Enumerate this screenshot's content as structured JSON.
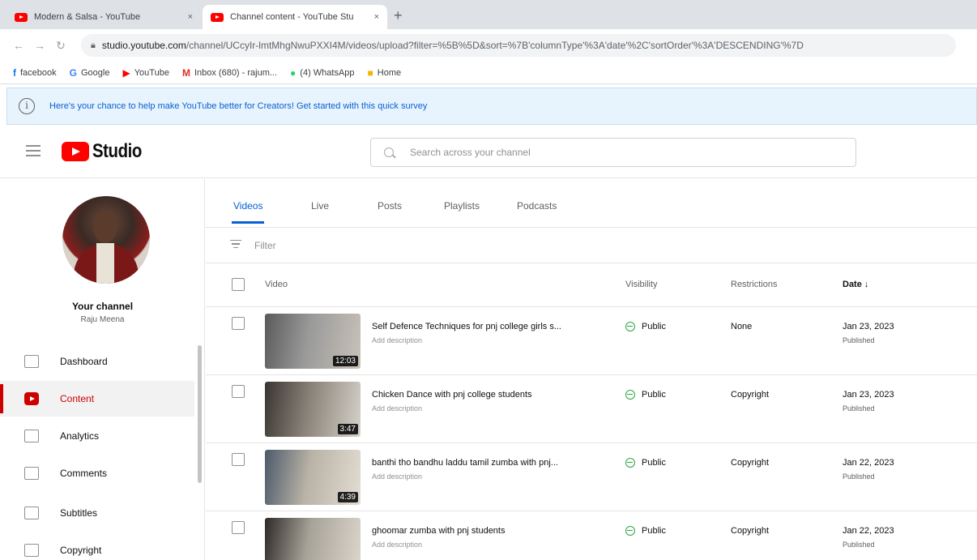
{
  "browser": {
    "tabs": [
      {
        "title": "Modern & Salsa - YouTube",
        "close": "×"
      },
      {
        "title": "Channel content - YouTube Stu",
        "close": "×"
      }
    ],
    "new_tab": "+",
    "url_host": "studio.youtube.com",
    "url_path": "/channel/UCcyIr-lmtMhgNwuPXXI4M/videos/upload?filter=%5B%5D&sort=%7B'columnType'%3A'date'%2C'sortOrder'%3A'DESCENDING'%7D",
    "bookmarks": [
      {
        "icon": "f",
        "label": "facebook"
      },
      {
        "icon": "G",
        "label": "Google"
      },
      {
        "icon": "▶",
        "label": "YouTube"
      },
      {
        "icon": "M",
        "label": "Inbox (680) - rajum..."
      },
      {
        "icon": "●",
        "label": "(4) WhatsApp"
      },
      {
        "icon": "■",
        "label": "Home"
      }
    ]
  },
  "banner": {
    "icon": "i",
    "text": "Here's your chance to help make YouTube better for Creators! Get started with this quick survey"
  },
  "header": {
    "logo_word": "Studio",
    "search_placeholder": "Search across your channel"
  },
  "sidebar": {
    "channel_name": "Your channel",
    "channel_sub": "Raju Meena",
    "items": [
      {
        "label": "Dashboard",
        "active": false
      },
      {
        "label": "Content",
        "active": true
      },
      {
        "label": "Analytics",
        "active": false
      },
      {
        "label": "Comments",
        "active": false
      },
      {
        "label": "Subtitles",
        "active": false
      },
      {
        "label": "Copyright",
        "active": false
      }
    ]
  },
  "content_tabs": [
    {
      "label": "Videos",
      "active": true
    },
    {
      "label": "Live",
      "active": false
    },
    {
      "label": "Posts",
      "active": false
    },
    {
      "label": "Playlists",
      "active": false
    },
    {
      "label": "Podcasts",
      "active": false
    }
  ],
  "filter": {
    "placeholder": "Filter"
  },
  "table": {
    "headers": {
      "video": "Video",
      "visibility": "Visibility",
      "restrictions": "Restrictions",
      "date": "Date ↓"
    },
    "rows": [
      {
        "title": "Self Defence Techniques for pnj college girls s...",
        "desc": "Add description",
        "duration": "12:03",
        "visibility": "Public",
        "restrictions": "None",
        "date": "Jan 23, 2023",
        "status": "Published",
        "thumb_colors": [
          "#5a5a5a",
          "#9a9a9a",
          "#c8c2b8"
        ]
      },
      {
        "title": "Chicken Dance with pnj college students",
        "desc": "Add description",
        "duration": "3:47",
        "visibility": "Public",
        "restrictions": "Copyright",
        "date": "Jan 23, 2023",
        "status": "Published",
        "thumb_colors": [
          "#3a3532",
          "#8a8278",
          "#d6d2ca"
        ]
      },
      {
        "title": "banthi tho bandhu laddu tamil zumba with pnj...",
        "desc": "Add description",
        "duration": "4:39",
        "visibility": "Public",
        "restrictions": "Copyright",
        "date": "Jan 22, 2023",
        "status": "Published",
        "thumb_colors": [
          "#4b5a6a",
          "#b9b2a6",
          "#e2dcd2"
        ]
      },
      {
        "title": "ghoomar zumba with pnj students",
        "desc": "Add description",
        "duration": "",
        "visibility": "Public",
        "restrictions": "Copyright",
        "date": "Jan 22, 2023",
        "status": "Published",
        "thumb_colors": [
          "#2e2a28",
          "#a8a398",
          "#dcd6cc"
        ]
      }
    ]
  }
}
